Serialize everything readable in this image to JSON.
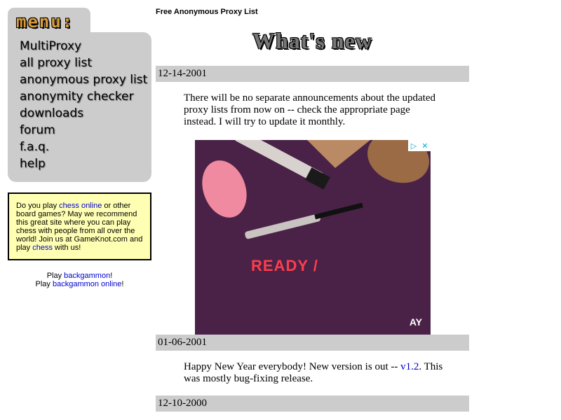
{
  "menu": {
    "logo": "menu:",
    "items": [
      {
        "label": "MultiProxy"
      },
      {
        "label": "all proxy list"
      },
      {
        "label": "anonymous proxy list"
      },
      {
        "label": "anonymity checker"
      },
      {
        "label": "downloads"
      },
      {
        "label": "forum"
      },
      {
        "label": "f.a.q."
      },
      {
        "label": "help"
      }
    ]
  },
  "chess_box": {
    "t1": "Do you play ",
    "link1": "chess online",
    "t2": " or other board games? May we recommend this great site where you can play chess with people from all over the world! Join us at GameKnot.com and play ",
    "link2": "chess",
    "t3": " with us!"
  },
  "backgammon": {
    "line1_prefix": "Play ",
    "line1_link": "backgammon",
    "line1_suffix": "!",
    "line2_prefix": "Play ",
    "line2_link": "backgammon online",
    "line2_suffix": "!"
  },
  "header": {
    "site_title": "Free Anonymous Proxy List",
    "heading": "What's new"
  },
  "news": [
    {
      "date": "12-14-2001",
      "text": "There will be no separate announcements about the updated proxy lists from now on -- check the appropriate page instead. I will try to update it monthly."
    },
    {
      "date": "01-06-2001",
      "text_before": "Happy New Year everybody! New version is out -- ",
      "link": "v1.2",
      "text_after": ". This was mostly bug-fixing release."
    },
    {
      "date": "12-10-2000"
    }
  ],
  "ad": {
    "headline": "READY /",
    "brand": "AY",
    "adchoices_icon": "play-triangle-icon",
    "close_icon": "close-icon"
  },
  "colors": {
    "menu_bg": "#cccccc",
    "date_bar_bg": "#cccccc",
    "chess_box_bg": "#ffffb3",
    "link": "#0000cc",
    "ad_bg": "#4a2247"
  }
}
